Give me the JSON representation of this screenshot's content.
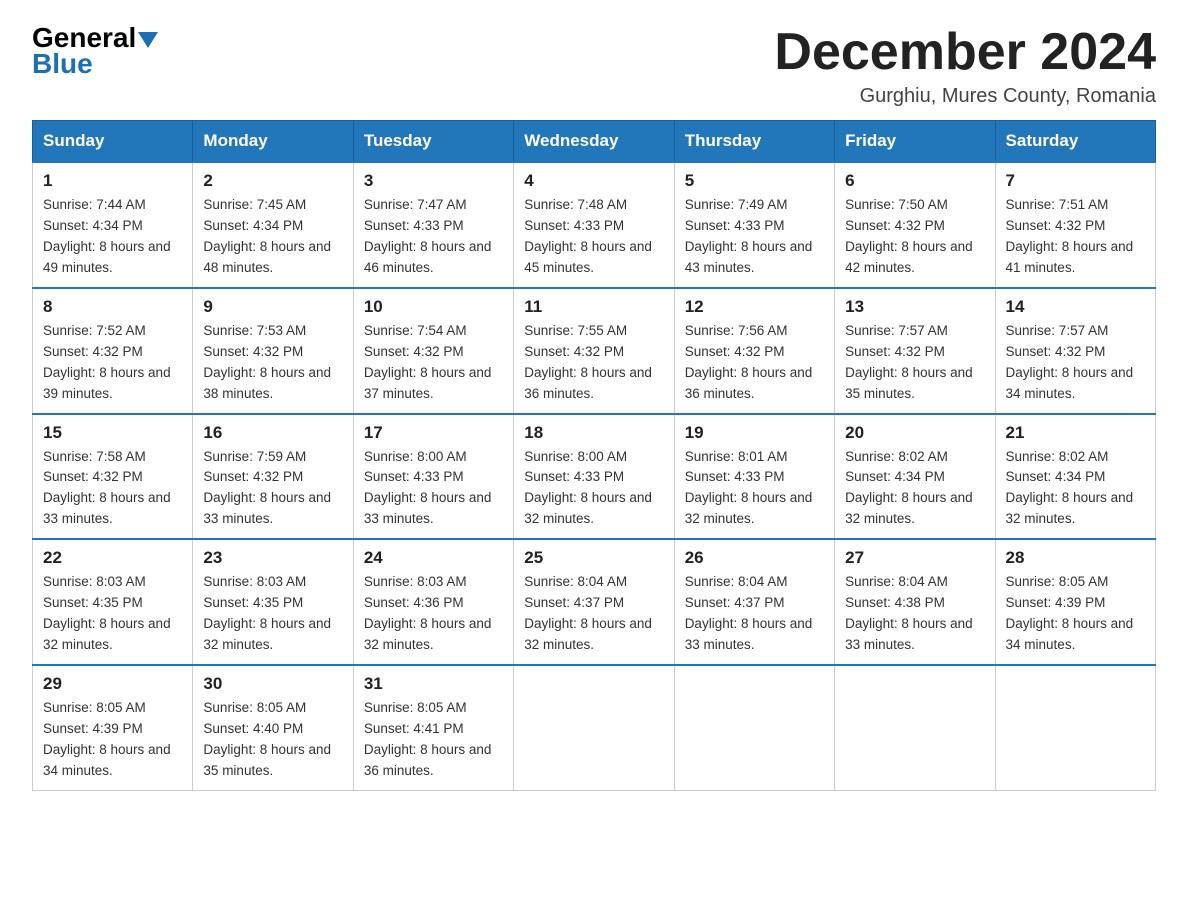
{
  "header": {
    "logo": {
      "general": "General",
      "blue": "Blue"
    },
    "title": "December 2024",
    "location": "Gurghiu, Mures County, Romania"
  },
  "weekdays": [
    "Sunday",
    "Monday",
    "Tuesday",
    "Wednesday",
    "Thursday",
    "Friday",
    "Saturday"
  ],
  "weeks": [
    [
      {
        "day": "1",
        "sunrise": "7:44 AM",
        "sunset": "4:34 PM",
        "daylight": "8 hours and 49 minutes."
      },
      {
        "day": "2",
        "sunrise": "7:45 AM",
        "sunset": "4:34 PM",
        "daylight": "8 hours and 48 minutes."
      },
      {
        "day": "3",
        "sunrise": "7:47 AM",
        "sunset": "4:33 PM",
        "daylight": "8 hours and 46 minutes."
      },
      {
        "day": "4",
        "sunrise": "7:48 AM",
        "sunset": "4:33 PM",
        "daylight": "8 hours and 45 minutes."
      },
      {
        "day": "5",
        "sunrise": "7:49 AM",
        "sunset": "4:33 PM",
        "daylight": "8 hours and 43 minutes."
      },
      {
        "day": "6",
        "sunrise": "7:50 AM",
        "sunset": "4:32 PM",
        "daylight": "8 hours and 42 minutes."
      },
      {
        "day": "7",
        "sunrise": "7:51 AM",
        "sunset": "4:32 PM",
        "daylight": "8 hours and 41 minutes."
      }
    ],
    [
      {
        "day": "8",
        "sunrise": "7:52 AM",
        "sunset": "4:32 PM",
        "daylight": "8 hours and 39 minutes."
      },
      {
        "day": "9",
        "sunrise": "7:53 AM",
        "sunset": "4:32 PM",
        "daylight": "8 hours and 38 minutes."
      },
      {
        "day": "10",
        "sunrise": "7:54 AM",
        "sunset": "4:32 PM",
        "daylight": "8 hours and 37 minutes."
      },
      {
        "day": "11",
        "sunrise": "7:55 AM",
        "sunset": "4:32 PM",
        "daylight": "8 hours and 36 minutes."
      },
      {
        "day": "12",
        "sunrise": "7:56 AM",
        "sunset": "4:32 PM",
        "daylight": "8 hours and 36 minutes."
      },
      {
        "day": "13",
        "sunrise": "7:57 AM",
        "sunset": "4:32 PM",
        "daylight": "8 hours and 35 minutes."
      },
      {
        "day": "14",
        "sunrise": "7:57 AM",
        "sunset": "4:32 PM",
        "daylight": "8 hours and 34 minutes."
      }
    ],
    [
      {
        "day": "15",
        "sunrise": "7:58 AM",
        "sunset": "4:32 PM",
        "daylight": "8 hours and 33 minutes."
      },
      {
        "day": "16",
        "sunrise": "7:59 AM",
        "sunset": "4:32 PM",
        "daylight": "8 hours and 33 minutes."
      },
      {
        "day": "17",
        "sunrise": "8:00 AM",
        "sunset": "4:33 PM",
        "daylight": "8 hours and 33 minutes."
      },
      {
        "day": "18",
        "sunrise": "8:00 AM",
        "sunset": "4:33 PM",
        "daylight": "8 hours and 32 minutes."
      },
      {
        "day": "19",
        "sunrise": "8:01 AM",
        "sunset": "4:33 PM",
        "daylight": "8 hours and 32 minutes."
      },
      {
        "day": "20",
        "sunrise": "8:02 AM",
        "sunset": "4:34 PM",
        "daylight": "8 hours and 32 minutes."
      },
      {
        "day": "21",
        "sunrise": "8:02 AM",
        "sunset": "4:34 PM",
        "daylight": "8 hours and 32 minutes."
      }
    ],
    [
      {
        "day": "22",
        "sunrise": "8:03 AM",
        "sunset": "4:35 PM",
        "daylight": "8 hours and 32 minutes."
      },
      {
        "day": "23",
        "sunrise": "8:03 AM",
        "sunset": "4:35 PM",
        "daylight": "8 hours and 32 minutes."
      },
      {
        "day": "24",
        "sunrise": "8:03 AM",
        "sunset": "4:36 PM",
        "daylight": "8 hours and 32 minutes."
      },
      {
        "day": "25",
        "sunrise": "8:04 AM",
        "sunset": "4:37 PM",
        "daylight": "8 hours and 32 minutes."
      },
      {
        "day": "26",
        "sunrise": "8:04 AM",
        "sunset": "4:37 PM",
        "daylight": "8 hours and 33 minutes."
      },
      {
        "day": "27",
        "sunrise": "8:04 AM",
        "sunset": "4:38 PM",
        "daylight": "8 hours and 33 minutes."
      },
      {
        "day": "28",
        "sunrise": "8:05 AM",
        "sunset": "4:39 PM",
        "daylight": "8 hours and 34 minutes."
      }
    ],
    [
      {
        "day": "29",
        "sunrise": "8:05 AM",
        "sunset": "4:39 PM",
        "daylight": "8 hours and 34 minutes."
      },
      {
        "day": "30",
        "sunrise": "8:05 AM",
        "sunset": "4:40 PM",
        "daylight": "8 hours and 35 minutes."
      },
      {
        "day": "31",
        "sunrise": "8:05 AM",
        "sunset": "4:41 PM",
        "daylight": "8 hours and 36 minutes."
      },
      null,
      null,
      null,
      null
    ]
  ]
}
